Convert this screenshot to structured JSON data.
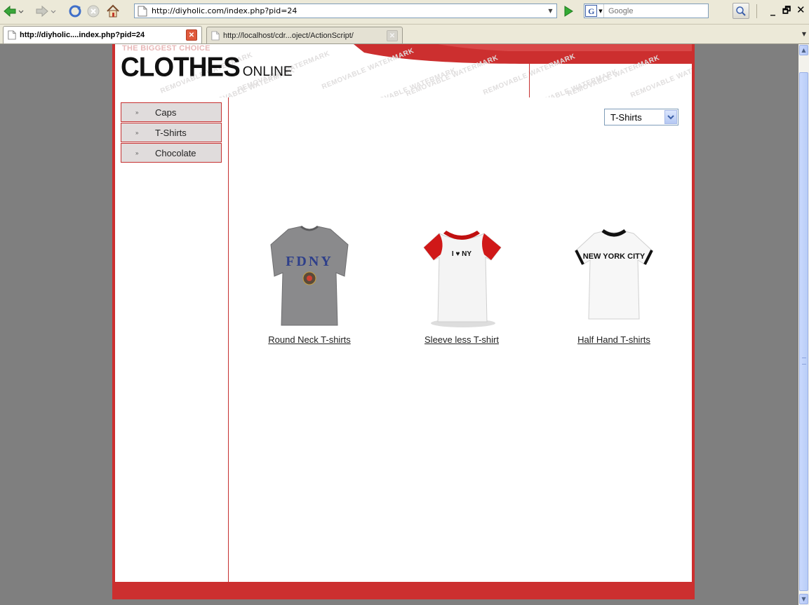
{
  "browser": {
    "address_url": "http://diyholic.com/index.php?pid=24",
    "search_placeholder": "Google",
    "search_engine_letter": "G",
    "tabs": [
      {
        "label": "http://diyholic....index.php?pid=24",
        "active": true
      },
      {
        "label": "http://localhost/cdr...oject/ActionScript/",
        "active": false
      }
    ],
    "window_buttons": {
      "minimize": "_",
      "restore": "🗗",
      "close": "✕"
    }
  },
  "site": {
    "tagline": "THE BIGGEST CHOICE",
    "logo_main": "CLOTHES",
    "logo_sub": "ONLINE",
    "watermark_text": "REMOVABLE WATERMARK",
    "brand_color": "#cc2f2f"
  },
  "sidebar": {
    "items": [
      {
        "label": "Caps"
      },
      {
        "label": "T-Shirts"
      },
      {
        "label": "Chocolate"
      }
    ]
  },
  "category_select": {
    "selected": "T-Shirts"
  },
  "products": [
    {
      "label": "Round Neck T-shirts",
      "image": "grey FDNY t-shirt",
      "shirt_text": "FDNY"
    },
    {
      "label": "Sleeve less T-shirt",
      "image": "white shirt with red sleeves, I love NY",
      "shirt_text": "I ♥ NY"
    },
    {
      "label": "Half Hand T-shirts",
      "image": "white ringer t-shirt, NEW YORK CITY",
      "shirt_text": "NEW YORK CITY"
    }
  ]
}
